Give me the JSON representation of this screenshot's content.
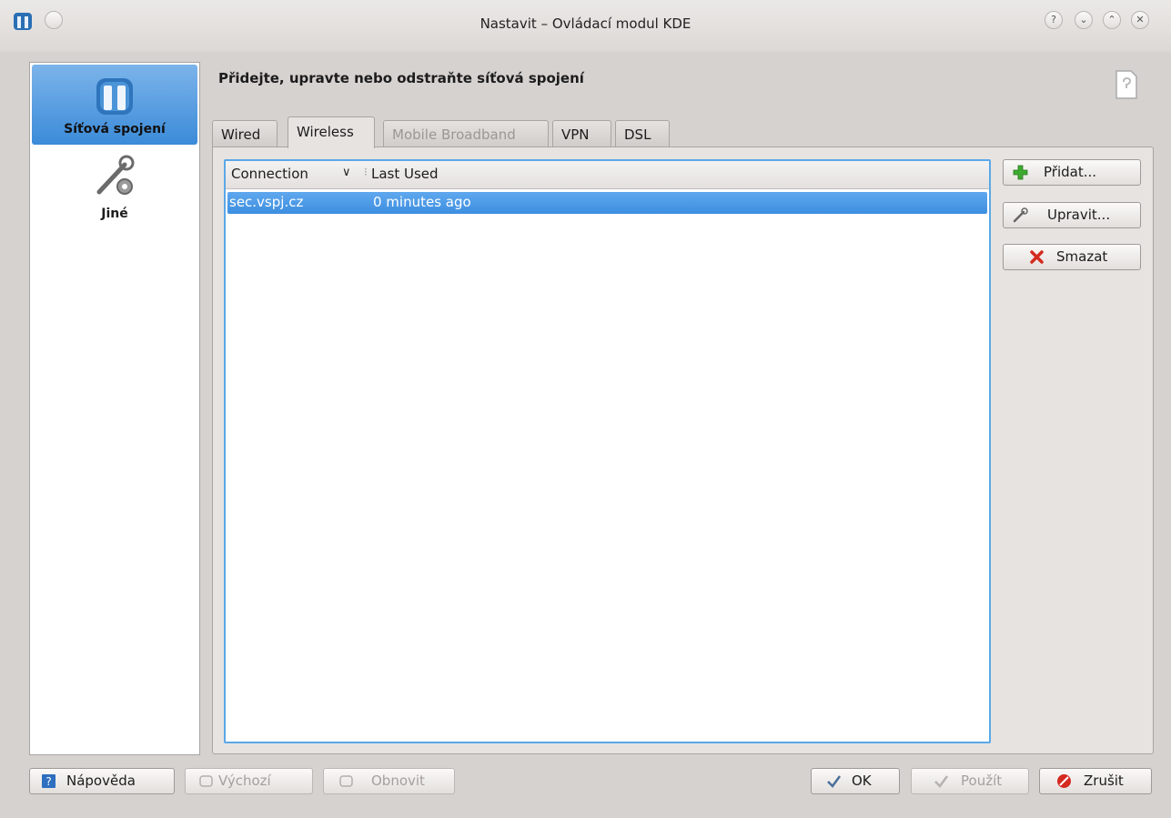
{
  "window": {
    "title": "Nastavit – Ovládací modul KDE"
  },
  "sidebar": {
    "items": [
      {
        "label": "Síťová spojení"
      },
      {
        "label": "Jiné"
      }
    ]
  },
  "main": {
    "heading": "Přidejte, upravte nebo odstraňte síťová spojení",
    "tabs": [
      {
        "label": "Wired",
        "state": "normal"
      },
      {
        "label": "Wireless",
        "state": "active"
      },
      {
        "label": "Mobile Broadband",
        "state": "disabled"
      },
      {
        "label": "VPN",
        "state": "normal"
      },
      {
        "label": "DSL",
        "state": "normal"
      }
    ],
    "table": {
      "columns": [
        "Connection",
        "Last Used"
      ],
      "rows": [
        {
          "connection": "sec.vspj.cz",
          "last_used": "0 minutes ago"
        }
      ]
    },
    "actions": {
      "add": "Přidat...",
      "edit": "Upravit...",
      "delete": "Smazat"
    }
  },
  "footer": {
    "help": "Nápověda",
    "defaults": "Výchozí",
    "reset": "Obnovit",
    "ok": "OK",
    "apply": "Použít",
    "cancel": "Zrušit"
  },
  "colors": {
    "selection": "#3d8ee0",
    "focus_border": "#5aa8e8",
    "background": "#d6d2d0"
  }
}
